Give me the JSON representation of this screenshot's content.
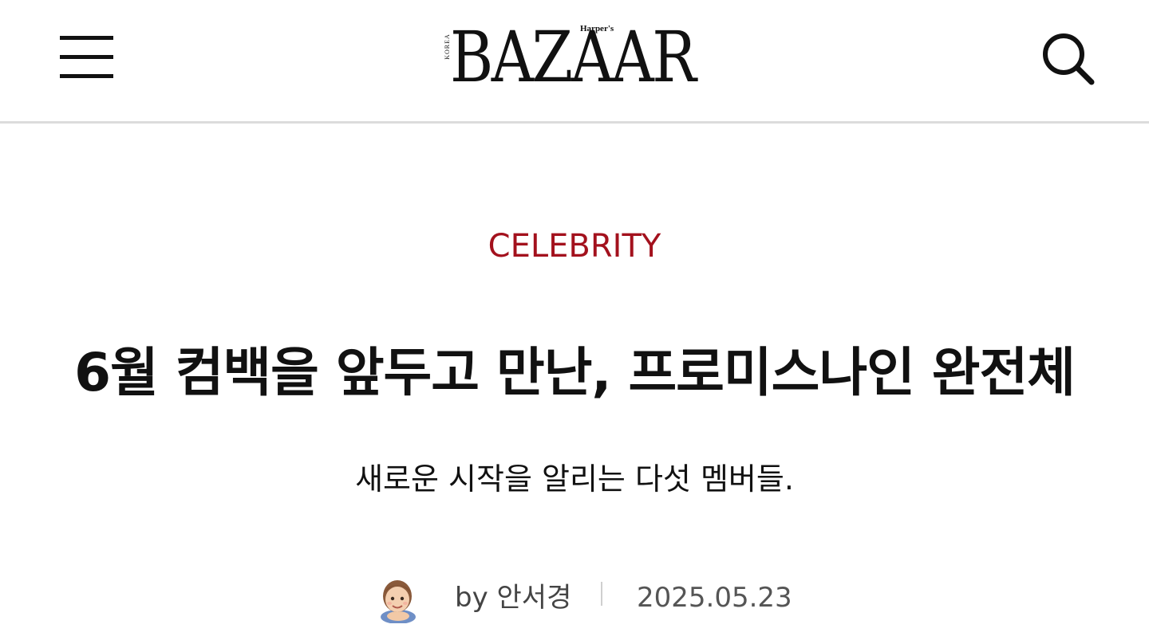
{
  "header": {
    "logo_text": "BAZAAR",
    "logo_edition": "KOREA",
    "logo_brand": "Harper's",
    "menu_icon": "hamburger-menu-icon",
    "search_icon": "search-icon"
  },
  "article": {
    "category": "CELEBRITY",
    "title": "6월 컴백을 앞두고 만난, 프로미스나인 완전체",
    "subtitle": "새로운 시작을 알리는 다섯 멤버들.",
    "author": "by 안서경",
    "date": "2025.05.23",
    "author_avatar_icon": "avatar-memoji-icon"
  },
  "colors": {
    "category": "#a3111d",
    "text": "#111111",
    "divider": "#dcdcdc"
  }
}
